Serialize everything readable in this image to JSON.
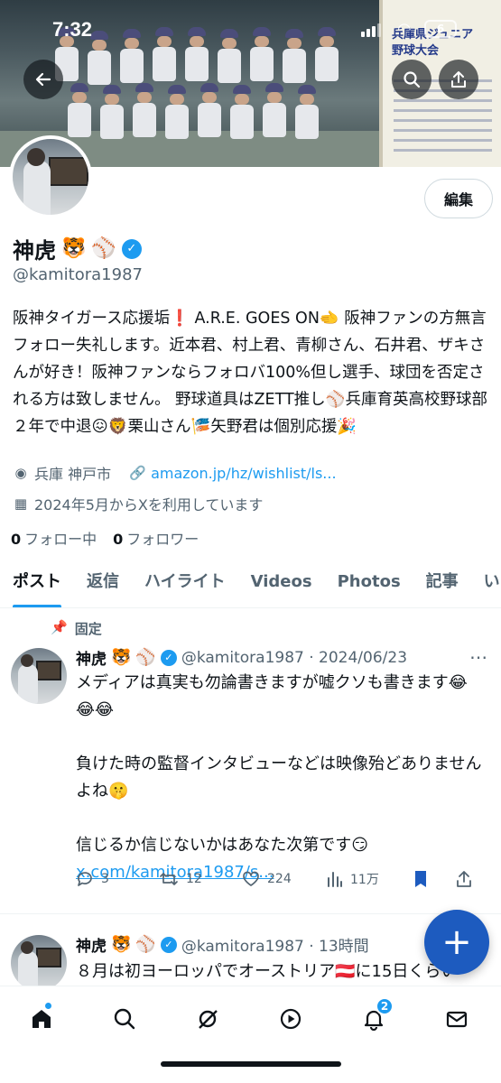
{
  "status_bar": {
    "time": "7:32",
    "battery": "6"
  },
  "banner": {
    "board_title": "兵庫県ジュニア\n野球大会"
  },
  "profile": {
    "edit_label": "編集",
    "name": "神虎",
    "name_emojis": [
      "🐯",
      "⚾"
    ],
    "handle": "@kamitora1987",
    "bio": "阪神タイガース応援垢❗ A.R.E. GOES ON🫲 阪神ファンの方無言フォロー失礼します。近本君、村上君、青柳さん、石井君、ザキさんが好き！阪神ファンならフォロバ100%但し選手、球団を否定される方は致しません。 野球道具はZETT推し⚾兵庫育英高校野球部２年で中退😖🦁栗山さん🎏矢野君は個別応援🎉",
    "location": "兵庫 神戸市",
    "website": "amazon.jp/hz/wishlist/ls...",
    "joined": "2024年5月からXを利用しています",
    "following_count": "0",
    "following_label": "フォロー中",
    "followers_count": "0",
    "followers_label": "フォロワー"
  },
  "tabs": [
    "ポスト",
    "返信",
    "ハイライト",
    "Videos",
    "Photos",
    "記事",
    "い"
  ],
  "posts": [
    {
      "pinned_label": "固定",
      "name": "神虎",
      "handle_time": "@kamitora1987 · 2024/06/23",
      "text_lines": [
        "メディアは真実も勿論書きますが嘘クソも書きます😂😂😂",
        "負けた時の監督インタビューなどは映像殆どありませんよね🤫",
        "信じるか信じないかはあなた次第です😏"
      ],
      "link": "x.com/kamitora1987/s...",
      "replies": "3",
      "reposts": "12",
      "likes": "224",
      "views": "11万"
    },
    {
      "name": "神虎",
      "handle_time": "@kamitora1987 · 13時間",
      "text": "８月は初ヨーロッパでオーストリア🇦🇹に15日くらい"
    }
  ],
  "icons": {
    "back": "arrow-left-icon",
    "search": "search-icon",
    "share": "share-icon",
    "location": "location-pin-icon",
    "link": "link-icon",
    "calendar": "calendar-icon",
    "pin": "pin-icon",
    "verified": "verified-badge-icon"
  },
  "nav": {
    "notifications_badge": "2"
  },
  "colors": {
    "accent": "#1d9bf0",
    "fab": "#1d5bbf",
    "text": "#0f1419",
    "secondary": "#536471"
  }
}
